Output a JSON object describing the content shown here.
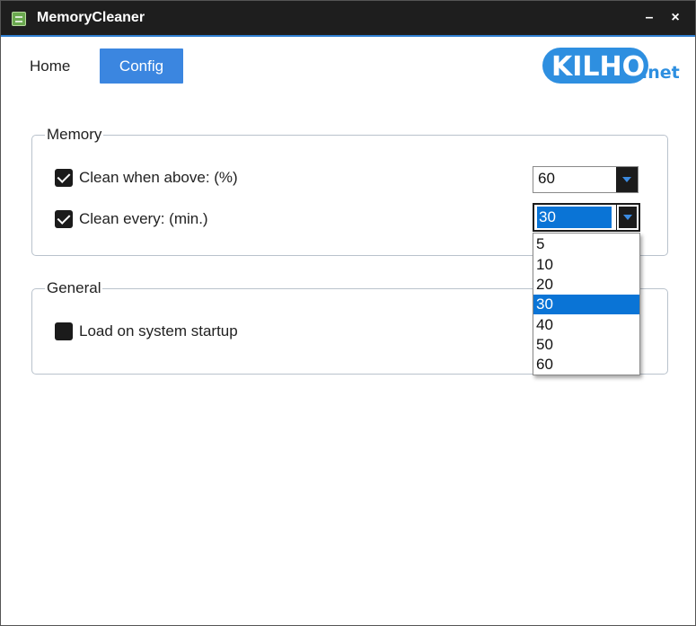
{
  "window": {
    "title": "MemoryCleaner",
    "minimize_label": "–",
    "close_label": "×"
  },
  "nav": {
    "home_label": "Home",
    "config_label": "Config"
  },
  "logo": {
    "main": "KILHO",
    "sub": ".net"
  },
  "memory_group": {
    "title": "Memory",
    "clean_above": {
      "label": "Clean when above: (%)",
      "checked": true,
      "value": "60"
    },
    "clean_every": {
      "label": "Clean every: (min.)",
      "checked": true,
      "value": "30"
    }
  },
  "dropdown": {
    "options": [
      "5",
      "10",
      "20",
      "30",
      "40",
      "50",
      "60"
    ],
    "selected": "30"
  },
  "general_group": {
    "title": "General",
    "load_startup": {
      "label": "Load on system startup",
      "checked": false
    }
  },
  "colors": {
    "accent": "#3b86e0",
    "titlebar": "#1e1e1e",
    "selection": "#0a74d6"
  }
}
